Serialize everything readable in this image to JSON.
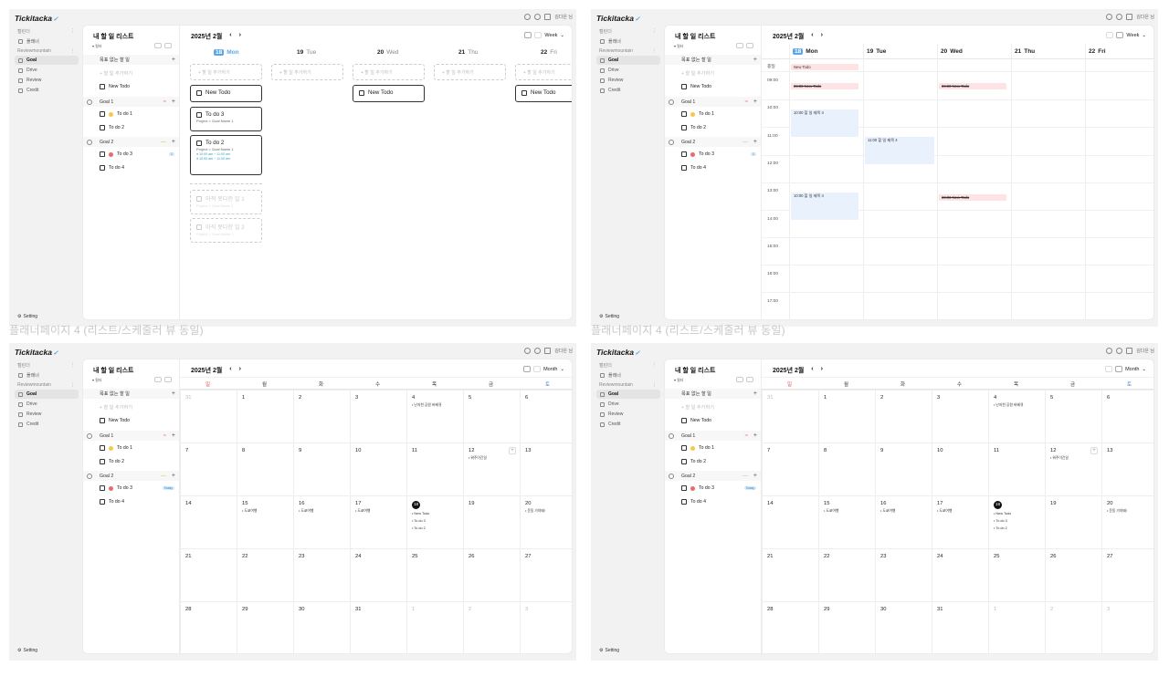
{
  "captions": {
    "c1": "플래너페이지 4 (리스트/스케줄러 뷰 동일)",
    "c2": "플래너페이지 4 (리스트/스케줄러 뷰 동일)"
  },
  "app": {
    "logo": "Tickitacka",
    "user": "김다은 님",
    "setting": "Setting"
  },
  "nav": {
    "section1": "캘린더",
    "planner": "플래너",
    "section2": "Reviewmountain",
    "items": [
      "Goal",
      "Drive",
      "Review",
      "Credit"
    ]
  },
  "todo": {
    "title": "내 할 일 리스트",
    "filter": "필터",
    "no_goal": "목표 없는 할 일",
    "add": "+ 할 일 추가하기",
    "new_todo": "New Todo",
    "goal1": "Goal 1",
    "todo1": "To do 1",
    "todo2": "To do 2",
    "goal2": "Goal 2",
    "todo3": "To do 3",
    "todo4": "To do 4",
    "today": "Today",
    "badge1": "1"
  },
  "calendar": {
    "month": "2025년 2월",
    "view_week": "Week",
    "view_month": "Month",
    "days": [
      {
        "n": "18",
        "d": "Mon"
      },
      {
        "n": "19",
        "d": "Tue"
      },
      {
        "n": "20",
        "d": "Wed"
      },
      {
        "n": "21",
        "d": "Thu"
      },
      {
        "n": "22",
        "d": "Fri"
      }
    ]
  },
  "week": {
    "add": "+ 할 일 추가하기",
    "new_todo": "New Todo",
    "card_todo3": "To do 3",
    "card_todo2": "To do 2",
    "project": "Project > Goal Name 1",
    "time1": "10:00 am ~ 11:00 am",
    "time2": "10:00 am ~ 11:00 am",
    "faded1": "아직 못다한 일 1",
    "faded2": "아직 못다한 일 2",
    "faded_sub": "Project > Goal Name 1"
  },
  "sched": {
    "allday": "종일",
    "hours": [
      "09:00",
      "10:00",
      "11:00",
      "12:00",
      "13:00",
      "14:00",
      "15:00",
      "16:00",
      "17:00"
    ],
    "ev_newtodo": "New Todo",
    "ev_strike1": "09:00 New Todo",
    "ev_strike2": "09:00 New Todo",
    "ev_b1": "10:00 할 일 제목 4",
    "ev_b2": "11:00 할 일 제목 4",
    "ev_b3": "10:00 할 일 제목 4",
    "ev_strike3": "20:00 New Todo"
  },
  "monthview": {
    "weekdays": [
      "일",
      "월",
      "화",
      "수",
      "목",
      "금",
      "토"
    ],
    "weeks": [
      [
        "31",
        "1",
        "2",
        "3",
        "4",
        "5",
        "6"
      ],
      [
        "7",
        "8",
        "9",
        "10",
        "11",
        "12",
        "13"
      ],
      [
        "14",
        "15",
        "16",
        "17",
        "18",
        "19",
        "20"
      ],
      [
        "21",
        "22",
        "23",
        "24",
        "25",
        "26",
        "27"
      ],
      [
        "28",
        "29",
        "30",
        "31",
        "1",
        "2",
        "3"
      ]
    ],
    "ev_trip": "난지천 공원 바베큐",
    "ev_birthday": "워주이긴일",
    "ev_travel": "도쿄여행",
    "ev_ex": "운동 가야돼!",
    "ev_new": "New Todo",
    "ev_t3": "To do 3",
    "ev_t2": "To do 2"
  },
  "colors": {
    "accent": "#5aa7e8",
    "sunday": "#e05050",
    "saturday": "#3a7bd5"
  }
}
